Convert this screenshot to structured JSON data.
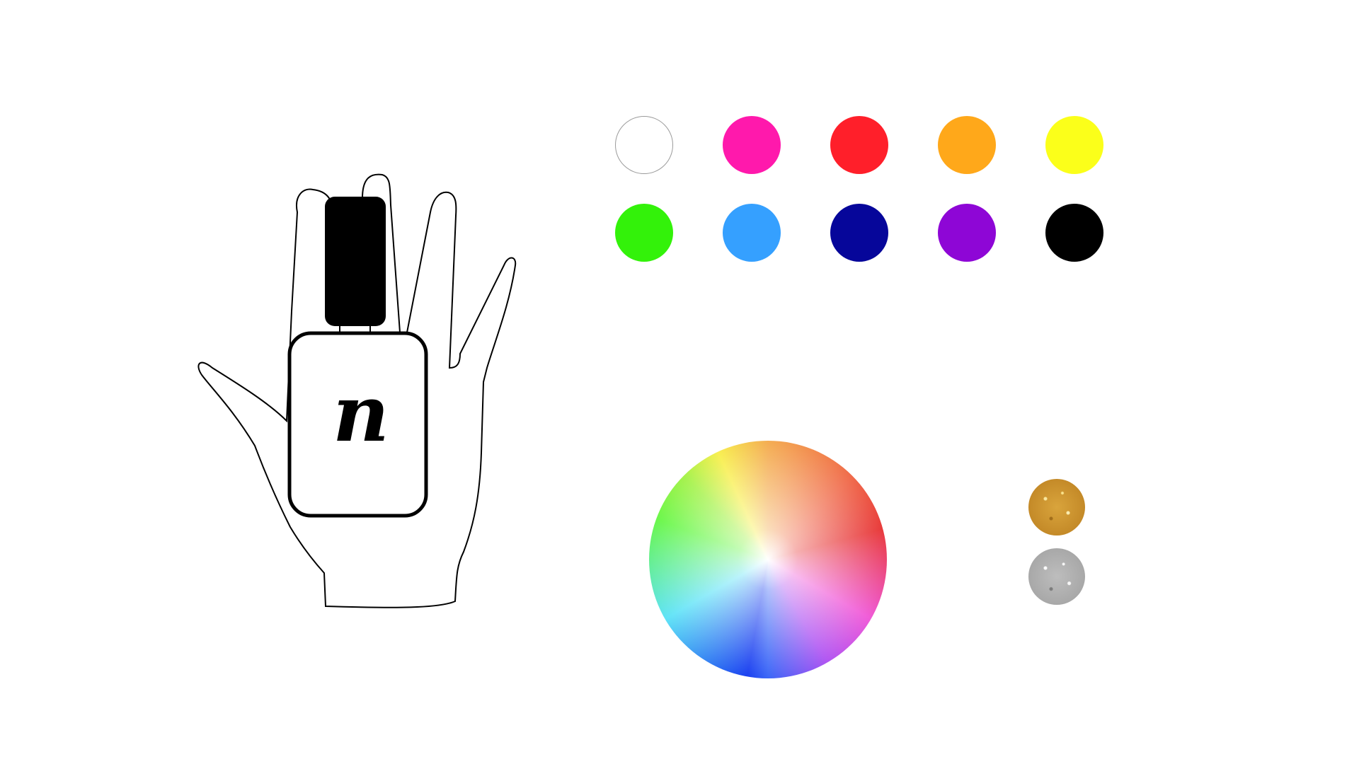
{
  "logo": {
    "letter": "n"
  },
  "palette": {
    "colors": [
      {
        "name": "white",
        "hex": "#ffffff"
      },
      {
        "name": "pink",
        "hex": "#ff19ac"
      },
      {
        "name": "red",
        "hex": "#ff1f2a"
      },
      {
        "name": "orange",
        "hex": "#ffa81a"
      },
      {
        "name": "yellow",
        "hex": "#fbff1a"
      },
      {
        "name": "green",
        "hex": "#33f20a"
      },
      {
        "name": "light-blue",
        "hex": "#35a0ff"
      },
      {
        "name": "navy",
        "hex": "#06069a"
      },
      {
        "name": "purple",
        "hex": "#8e06d6"
      },
      {
        "name": "black",
        "hex": "#000000"
      }
    ]
  },
  "glitters": [
    {
      "name": "gold-glitter",
      "hex": "#c48a28"
    },
    {
      "name": "silver-glitter",
      "hex": "#a8a8a8"
    }
  ],
  "hand": {
    "outline_color": "#000000",
    "bottle_cap_color": "#000000"
  }
}
